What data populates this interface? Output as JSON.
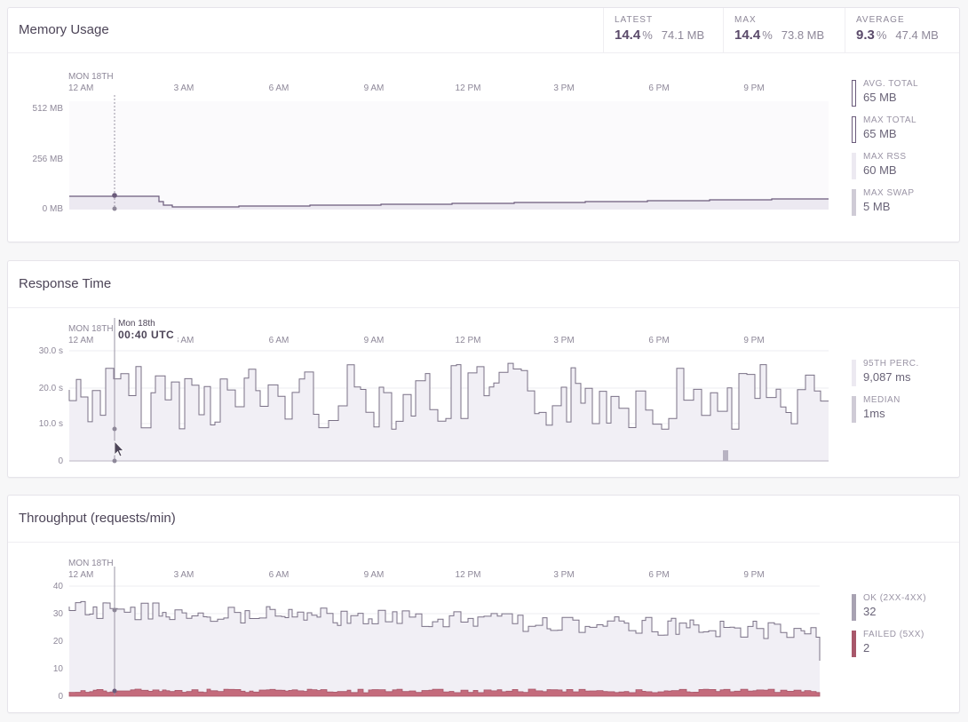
{
  "memory": {
    "title": "Memory Usage",
    "stats": [
      {
        "label": "LATEST",
        "pct": "14.4",
        "pct_unit": "%",
        "mb": "74.1 MB"
      },
      {
        "label": "MAX",
        "pct": "14.4",
        "pct_unit": "%",
        "mb": "73.8 MB"
      },
      {
        "label": "AVERAGE",
        "pct": "9.3",
        "pct_unit": "%",
        "mb": "47.4 MB"
      }
    ],
    "date_label": "MON 18TH",
    "x_labels": [
      "12 AM",
      "3 AM",
      "6 AM",
      "9 AM",
      "12 PM",
      "3 PM",
      "6 PM",
      "9 PM"
    ],
    "y_labels": [
      "512 MB",
      "256 MB",
      "0 MB"
    ],
    "legend": [
      {
        "label": "AVG. TOTAL",
        "value": "65",
        "unit": "MB",
        "color": "#6b5b7b"
      },
      {
        "label": "MAX TOTAL",
        "value": "65",
        "unit": "MB",
        "color": "#6b5b7b"
      },
      {
        "label": "MAX RSS",
        "value": "60",
        "unit": "MB",
        "color": "#ece9f1"
      },
      {
        "label": "MAX SWAP",
        "value": "5",
        "unit": "MB",
        "color": "#cfcbd6"
      }
    ]
  },
  "response": {
    "title": "Response Time",
    "date_label": "MON 18TH",
    "tooltip": {
      "date": "Mon 18th",
      "time": "00:40 UTC"
    },
    "x_labels": [
      "12 AM",
      "3 AM",
      "6 AM",
      "9 AM",
      "12 PM",
      "3 PM",
      "6 PM",
      "9 PM"
    ],
    "y_labels": [
      "30.0 s",
      "20.0 s",
      "10.0 s",
      "0"
    ],
    "legend": [
      {
        "label": "95TH PERC.",
        "value": "9,087",
        "unit": "ms",
        "color": "#ece9f1"
      },
      {
        "label": "MEDIAN",
        "value": "1",
        "unit": "ms",
        "color": "#cfcbd6"
      }
    ]
  },
  "throughput": {
    "title": "Throughput (requests/min)",
    "date_label": "MON 18TH",
    "x_labels": [
      "12 AM",
      "3 AM",
      "6 AM",
      "9 AM",
      "12 PM",
      "3 PM",
      "6 PM",
      "9 PM"
    ],
    "y_labels": [
      "40",
      "30",
      "20",
      "10",
      "0"
    ],
    "legend": [
      {
        "label": "OK (2XX-4XX)",
        "value": "32",
        "unit": "",
        "color": "#a8a2b2"
      },
      {
        "label": "FAILED (5XX)",
        "value": "2",
        "unit": "",
        "color": "#a8576a"
      }
    ]
  },
  "colors": {
    "accent": "#5a4a6a",
    "fill": "#f1eff5",
    "line": "#6b5b7b",
    "failed": "#c46b7c"
  }
}
